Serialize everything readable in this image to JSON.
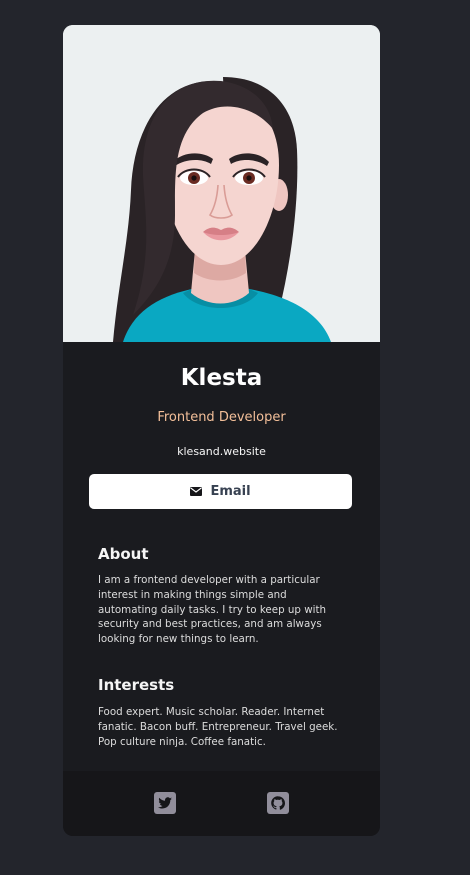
{
  "profile": {
    "name": "Klesta",
    "role": "Frontend Developer",
    "website": "klesand.website",
    "email_label": "Email"
  },
  "about": {
    "title": "About",
    "text": "I am a frontend developer with a particular interest in making things simple and automating daily tasks. I try to keep up with security and best practices, and am always looking for new things to learn."
  },
  "interests": {
    "title": "Interests",
    "text": "Food expert. Music scholar. Reader. Internet fanatic. Bacon buff. Entrepreneur. Travel geek. Pop culture ninja. Coffee fanatic."
  },
  "footer": {
    "icons": [
      "twitter-icon",
      "github-icon"
    ]
  },
  "colors": {
    "page_bg": "#23252c",
    "card_bg": "#1a1b1f",
    "footer_bg": "#161619",
    "accent": "#f3bf99",
    "icon": "#918e9b"
  }
}
